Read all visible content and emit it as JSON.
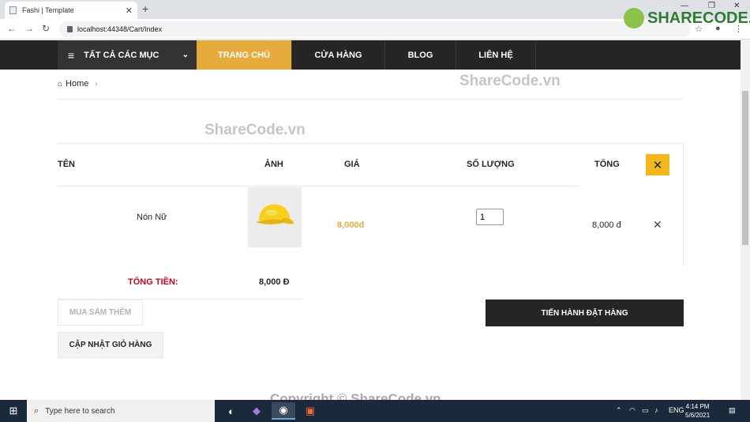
{
  "browser": {
    "tab_title": "Fashi | Template",
    "url": "localhost:44348/Cart/Index",
    "new_tab_glyph": "+",
    "close_glyph": "✕"
  },
  "nav": {
    "categories_label": "TẤT CẢ CÁC MỤC",
    "items": [
      "TRANG CHỦ",
      "CỬA HÀNG",
      "BLOG",
      "LIÊN HỆ"
    ],
    "active_index": 0,
    "accent": "#e7ab3c"
  },
  "breadcrumb": {
    "home": "Home"
  },
  "watermarks": {
    "top": "ShareCode.vn",
    "mid": "ShareCode.vn",
    "bottom": "Copyright © ShareCode.vn",
    "logo": "SHARECODE.vn"
  },
  "cart": {
    "headers": {
      "name": "TÊN",
      "image": "ẢNH",
      "price": "GIÁ",
      "qty": "SỐ LƯỢNG",
      "total": "TỔNG"
    },
    "rows": [
      {
        "name": "Nón Nữ",
        "image_icon": "yellow-cap-image",
        "price": "8,000đ",
        "qty": "1",
        "total": "8,000 đ"
      }
    ],
    "total_label": "TỔNG TIỀN:",
    "total_value": "8,000 Đ",
    "continue_label": "MUA SẮM THÊM",
    "update_label": "CẬP NHẬT GIỎ HÀNG",
    "checkout_label": "TIẾN HÀNH ĐẶT HÀNG"
  },
  "taskbar": {
    "search_placeholder": "Type here to search",
    "lang": "ENG",
    "time": "4:14 PM",
    "date": "5/6/2021"
  }
}
